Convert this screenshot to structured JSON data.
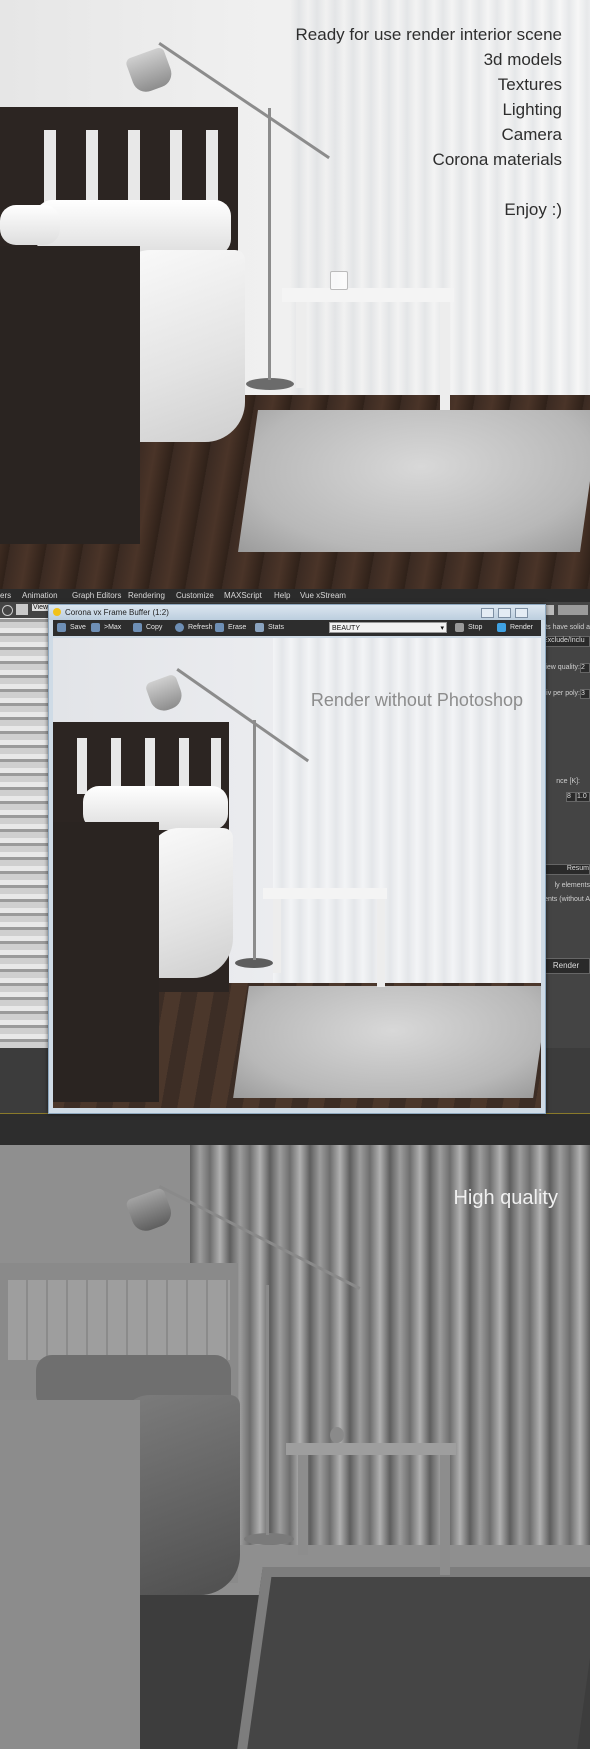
{
  "section_top": {
    "overlay_lines": [
      "Ready for use render interior scene",
      "3d models",
      "Textures",
      "Lighting",
      "Camera",
      "Corona materials",
      "Enjoy :)"
    ]
  },
  "max_ui": {
    "menu": [
      "ers",
      "Animation",
      "Graph Editors",
      "Rendering",
      "Customize",
      "MAXScript",
      "Help",
      "Vue xStream"
    ],
    "viewport_label": "View",
    "right_panel": {
      "labels": [
        "ects have solid a",
        "Exclude/Inclu",
        "view quality:",
        "div per poly:",
        "nce [K]:",
        "ly elements",
        "ents (without A",
        "Resum",
        "Render"
      ],
      "fields": [
        "2",
        "3",
        "8",
        "1.0"
      ]
    }
  },
  "vfb": {
    "title": "Corona vx Frame Buffer (1:2)",
    "buttons": {
      "save": "Save",
      "max": ">Max",
      "copy": "Copy",
      "refresh": "Refresh",
      "erase": "Erase",
      "stats": "Stats",
      "stop": "Stop",
      "render": "Render"
    },
    "channel": "BEAUTY",
    "caption": "Render without Photoshop"
  },
  "section_bottom": {
    "caption": "High quality"
  }
}
